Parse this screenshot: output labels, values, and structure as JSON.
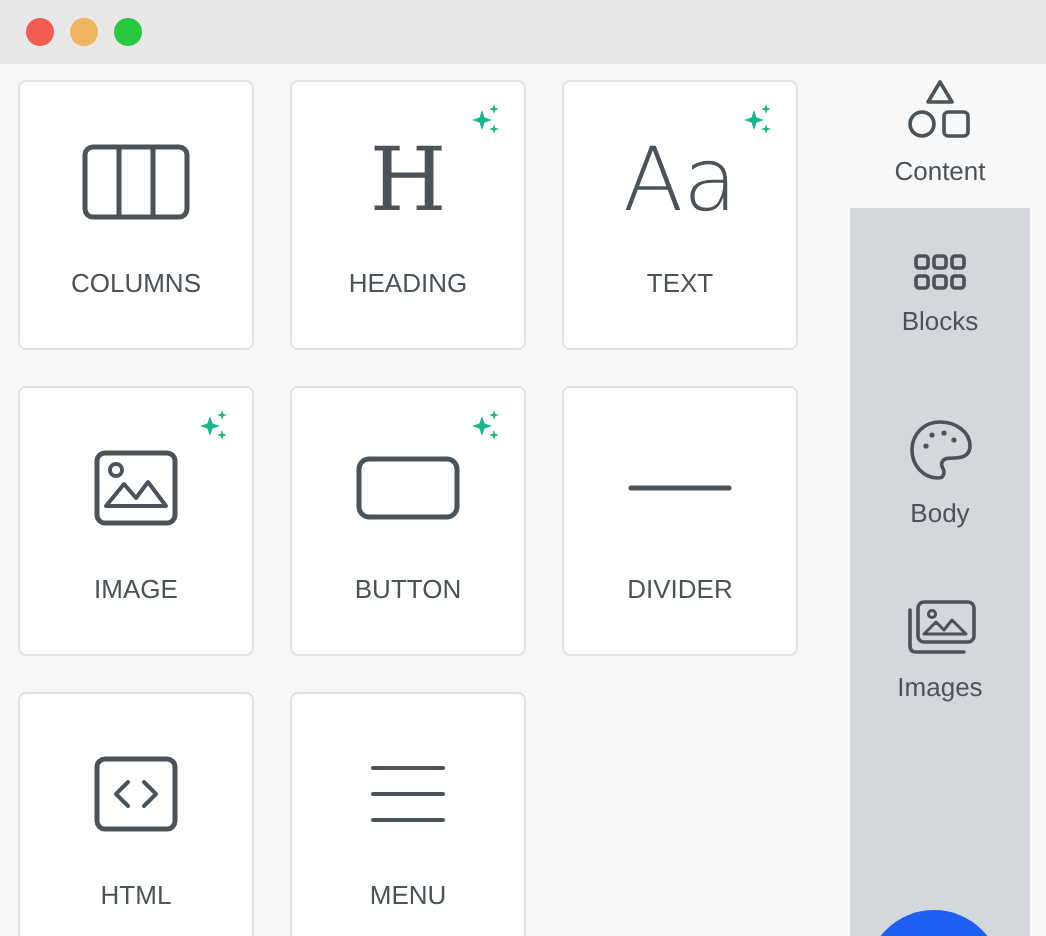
{
  "tiles": [
    {
      "kind": "columns",
      "label": "COLUMNS",
      "ai": false
    },
    {
      "kind": "heading",
      "glyph": "H",
      "label": "HEADING",
      "ai": true
    },
    {
      "kind": "text",
      "glyph": "Aa",
      "label": "TEXT",
      "ai": true
    },
    {
      "kind": "image",
      "label": "IMAGE",
      "ai": true
    },
    {
      "kind": "button",
      "label": "BUTTON",
      "ai": true
    },
    {
      "kind": "divider",
      "label": "DIVIDER",
      "ai": false
    },
    {
      "kind": "html",
      "label": "HTML",
      "ai": false
    },
    {
      "kind": "menu",
      "label": "MENU",
      "ai": false
    }
  ],
  "sidebar": {
    "items": [
      {
        "kind": "content",
        "label": "Content",
        "selected": true
      },
      {
        "kind": "blocks",
        "label": "Blocks",
        "selected": false
      },
      {
        "kind": "body",
        "label": "Body",
        "selected": false
      },
      {
        "kind": "images",
        "label": "Images",
        "selected": false
      }
    ]
  }
}
